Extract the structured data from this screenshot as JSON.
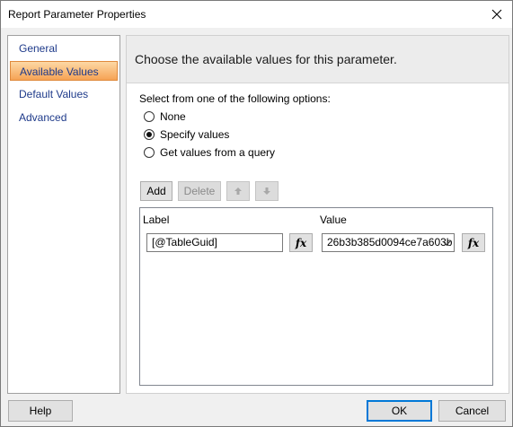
{
  "window": {
    "title": "Report Parameter Properties"
  },
  "nav": {
    "items": [
      {
        "label": "General"
      },
      {
        "label": "Available Values"
      },
      {
        "label": "Default Values"
      },
      {
        "label": "Advanced"
      }
    ],
    "selected": "Available Values"
  },
  "content": {
    "header": "Choose the available values for this parameter.",
    "options_label": "Select from one of the following options:",
    "options": [
      {
        "label": "None",
        "checked": false
      },
      {
        "label": "Specify values",
        "checked": true
      },
      {
        "label": "Get values from a query",
        "checked": false
      }
    ]
  },
  "toolbar": {
    "add_label": "Add",
    "delete_label": "Delete"
  },
  "grid": {
    "columns": [
      "Label",
      "Value"
    ],
    "rows": [
      {
        "label": "[@TableGuid]",
        "value": "26b3b385d0094ce7a603b",
        "fx": "fx"
      }
    ]
  },
  "footer": {
    "help_label": "Help",
    "ok_label": "OK",
    "cancel_label": "Cancel"
  },
  "colors": {
    "selected_nav_gradient_top": "#fdd8a5",
    "selected_nav_gradient_bottom": "#f6a355",
    "nav_text": "#1e3a8a",
    "primary_border": "#0078d7"
  }
}
